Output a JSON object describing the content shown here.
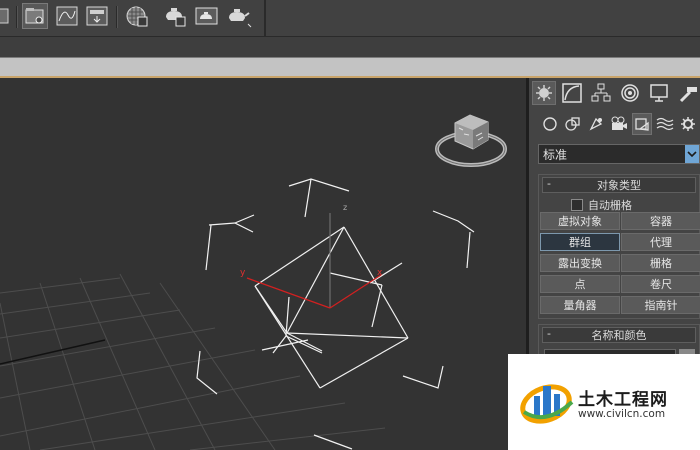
{
  "toolbar": {
    "icons": [
      "partial-icon",
      "open-explorer-icon",
      "curve-editor-icon",
      "dope-sheet-icon",
      "material-editor-icon",
      "render-setup-icon",
      "rendered-frame-icon",
      "render-icon"
    ]
  },
  "command_panel": {
    "tabs": [
      "create-icon",
      "modify-icon",
      "hierarchy-icon",
      "motion-icon",
      "display-icon",
      "utilities-icon"
    ],
    "sub_tabs": [
      "geometry-icon",
      "shapes-icon",
      "lights-icon",
      "cameras-icon",
      "helpers-icon",
      "space-warps-icon",
      "systems-icon"
    ],
    "category_value": "标准",
    "object_type": {
      "title": "对象类型",
      "toggle": "-",
      "autogrid_label": "自动栅格",
      "buttons": [
        "虚拟对象",
        "容器",
        "群组",
        "代理",
        "露出变换",
        "栅格",
        "点",
        "卷尺",
        "量角器",
        "指南针"
      ],
      "active_button": "群组"
    },
    "name_color": {
      "title": "名称和颜色",
      "toggle": "-"
    }
  },
  "viewport": {
    "axis_labels": {
      "x": "x",
      "y": "y",
      "z": "z"
    }
  },
  "watermark": {
    "name": "土木工程网",
    "url": "www.civilcn.com"
  },
  "colors": {
    "viewport_bg": "#333333",
    "panel_bg": "#444444",
    "active_button": "#2c3640",
    "accent_blue": "#6fa6d6"
  }
}
